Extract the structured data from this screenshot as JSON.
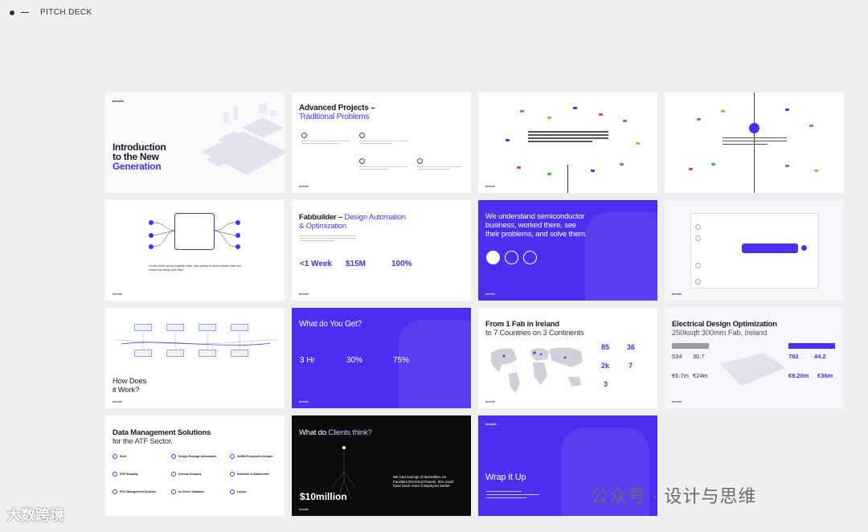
{
  "header": {
    "title": "PITCH DECK"
  },
  "brand": "beesite",
  "slides": {
    "s1": {
      "title_lines": [
        "Introduction",
        "to the New",
        "Generation"
      ]
    },
    "s2": {
      "title": "Advanced Projects –",
      "subtitle": "Traditional Problems"
    },
    "s5": {
      "quote": "Go this clever plucky engineer Brian, who wanted to semiconductor fabs and knows how things work there."
    },
    "s6": {
      "title": "Fabbuilder –",
      "title_accent": "Design Automation",
      "subtitle": "& Optimization",
      "stats": [
        {
          "value": "<1 Week"
        },
        {
          "value": "$15M"
        },
        {
          "value": "100%"
        }
      ]
    },
    "s7": {
      "title_lines": [
        "We understand semiconductor",
        "business, worked there, see",
        "their problems, and solve them."
      ]
    },
    "s9": {
      "title_lines": [
        "How Does",
        "it Work?"
      ]
    },
    "s10": {
      "title": "What do You Get?",
      "stats": [
        {
          "value": "3 Hr"
        },
        {
          "value": "30%"
        },
        {
          "value": "75%"
        }
      ]
    },
    "s11": {
      "title": "From 1 Fab in Ireland",
      "subtitle": "to 7 Countries on 3 Continents",
      "numbers": [
        {
          "value": "85"
        },
        {
          "value": "36"
        },
        {
          "value": "2k"
        },
        {
          "value": "7"
        },
        {
          "value": "3"
        }
      ]
    },
    "s12": {
      "title": "Electrical Design Optimization",
      "subtitle": "250ksqft 300mm Fab, Ireland",
      "left_stats": [
        {
          "value": "534"
        },
        {
          "value": "30.7"
        },
        {
          "value": "€6.7m"
        },
        {
          "value": "€24m"
        }
      ],
      "right_stats": [
        {
          "value": "792"
        },
        {
          "value": "44.2"
        },
        {
          "value": "€8.20m"
        },
        {
          "value": "€36m"
        }
      ]
    },
    "s13": {
      "title": "Data Management Solutions",
      "subtitle": "for the ATF Sector.",
      "items": [
        {
          "label": "Seeit"
        },
        {
          "label": "Design Package Automation"
        },
        {
          "label": "3D/BIX Ecosystem Scraper"
        },
        {
          "label": "PDF Scrapbly"
        },
        {
          "label": "Arizona Scrapbly"
        },
        {
          "label": "Schedule & Stakeholder"
        },
        {
          "label": "PDC Management Systems"
        },
        {
          "label": "AI Driven Database"
        },
        {
          "label": "Layout"
        }
      ]
    },
    "s14": {
      "title": "What do",
      "title_accent": "Clients think?",
      "big_value": "$10million",
      "quote": "We had savings of $10million on Facilities Electrical Panels, this could have been more if deployed earlier"
    },
    "s15": {
      "title": "Wrap It Up"
    }
  },
  "watermark": {
    "left": "大数跨境",
    "right": "公众号 · 设计与思维"
  },
  "colors": {
    "accent": "#4b2ef0",
    "background": "#efeff1"
  }
}
